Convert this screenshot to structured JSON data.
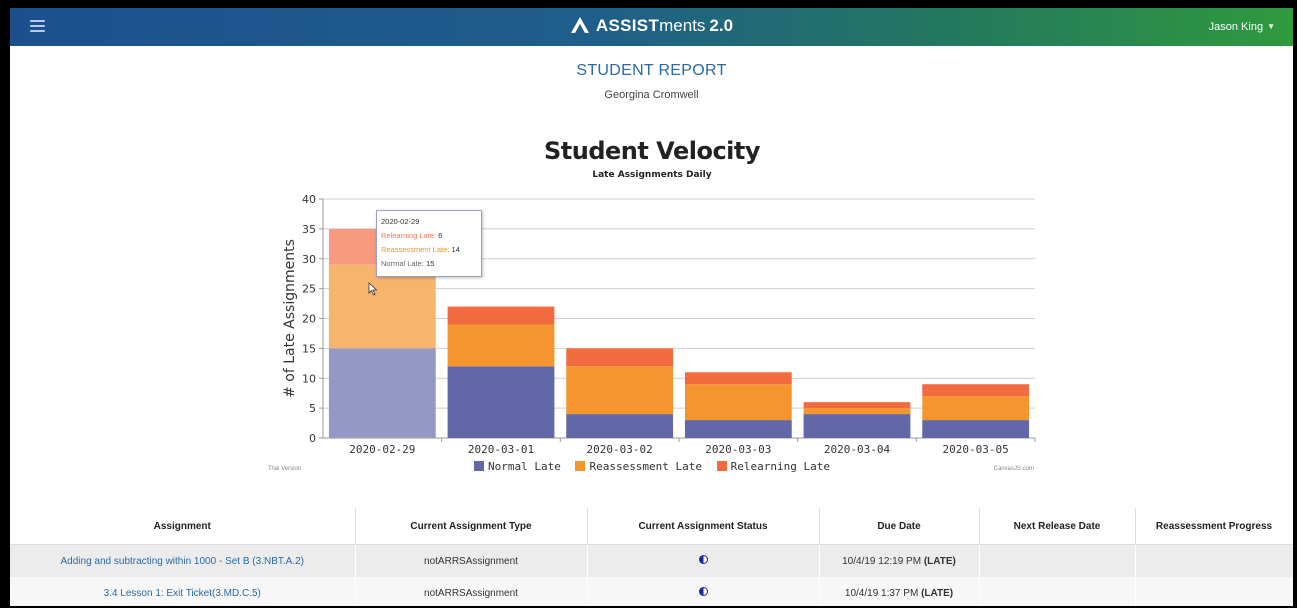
{
  "navbar": {
    "brand_bold": "ASSIST",
    "brand_light": "ments",
    "brand_version": "2.0",
    "user_name": "Jason King"
  },
  "report": {
    "title": "STUDENT REPORT",
    "student_name": "Georgina Cromwell"
  },
  "chart_data": {
    "type": "bar",
    "stacked": true,
    "title": "Student Velocity",
    "subtitle": "Late Assignments Daily",
    "xlabel": "",
    "ylabel": "# of Late Assignments",
    "ylim": [
      0,
      40
    ],
    "yticks": [
      0,
      5,
      10,
      15,
      20,
      25,
      30,
      35,
      40
    ],
    "grid": true,
    "legend_position": "bottom",
    "categories": [
      "2020-02-29",
      "2020-03-01",
      "2020-03-02",
      "2020-03-03",
      "2020-03-04",
      "2020-03-05"
    ],
    "series": [
      {
        "name": "Normal Late",
        "color": "#6267a8",
        "values": [
          15,
          12,
          4,
          3,
          4,
          3
        ]
      },
      {
        "name": "Reassessment Late",
        "color": "#f5952e",
        "values": [
          14,
          7,
          8,
          6,
          1,
          4
        ]
      },
      {
        "name": "Relearning Late",
        "color": "#f26b3e",
        "values": [
          6,
          3,
          3,
          2,
          1,
          2
        ]
      }
    ],
    "highlighted_index": 0,
    "tooltip": {
      "date": "2020-02-29",
      "relearning_label": "Relearning Late:",
      "relearning_value": "6",
      "reassessment_label": "Reassessment Late:",
      "reassessment_value": "14",
      "normal_label": "Normal Late:",
      "normal_value": "15"
    },
    "trial_text": "Trial Version",
    "credit_text": "CanvasJS.com"
  },
  "table": {
    "headers": [
      "Assignment",
      "Current Assignment Type",
      "Current Assignment Status",
      "Due Date",
      "Next Release Date",
      "Reassessment Progress"
    ],
    "rows": [
      {
        "assignment": "Adding and subtracting within 1000 - Set B (3.NBT.A.2)",
        "type": "notARRSAssignment",
        "due": "10/4/19 12:19 PM",
        "late": "(LATE)",
        "next_release": "",
        "progress": ""
      },
      {
        "assignment": "3.4 Lesson 1: Exit Ticket(3.MD.C.5)",
        "type": "notARRSAssignment",
        "due": "10/4/19 1:37 PM",
        "late": "(LATE)",
        "next_release": "",
        "progress": ""
      }
    ]
  }
}
